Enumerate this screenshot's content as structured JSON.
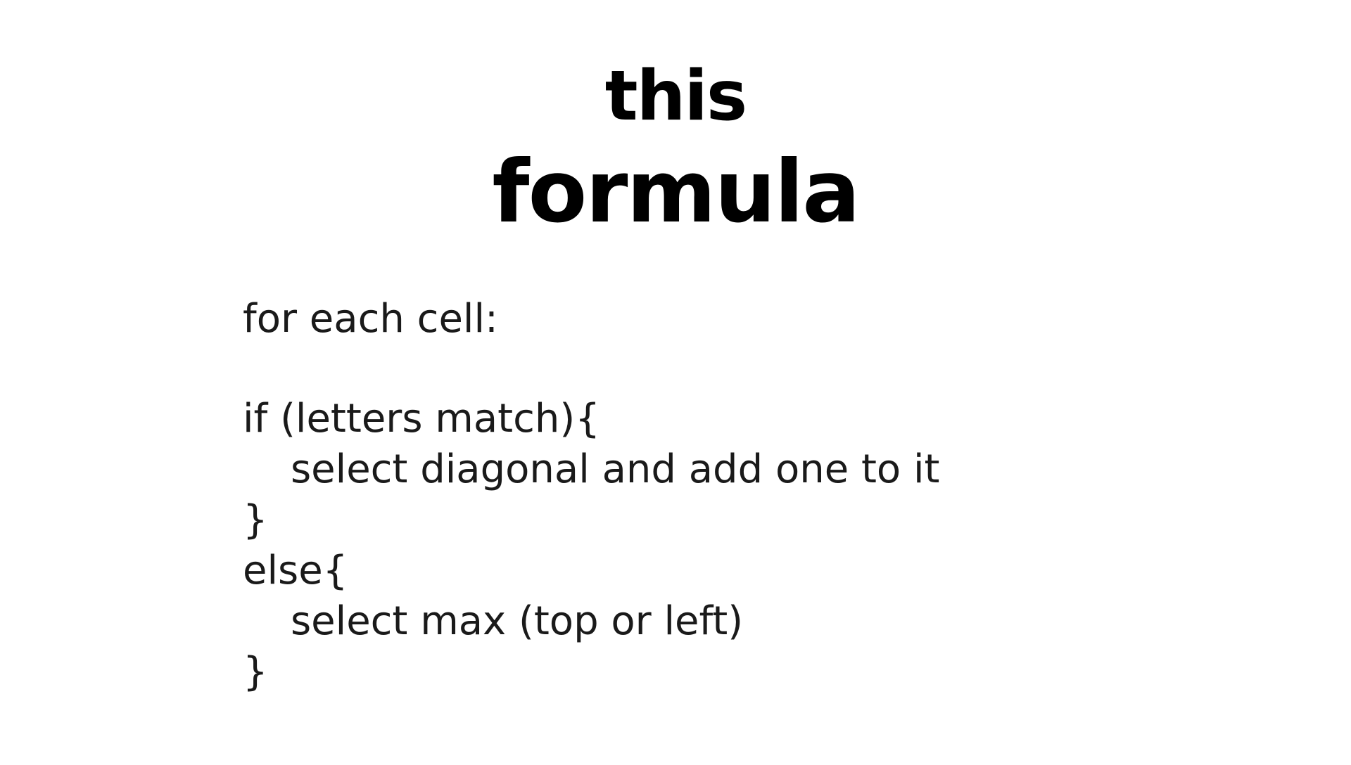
{
  "title": {
    "line1": "this",
    "line2": "formula"
  },
  "pseudocode": {
    "line1": "for each cell:",
    "line2": "if (letters match){",
    "line3": "select diagonal and add one to it",
    "line4": "}",
    "line5": "else{",
    "line6": "select max (top or left)",
    "line7": "}"
  }
}
